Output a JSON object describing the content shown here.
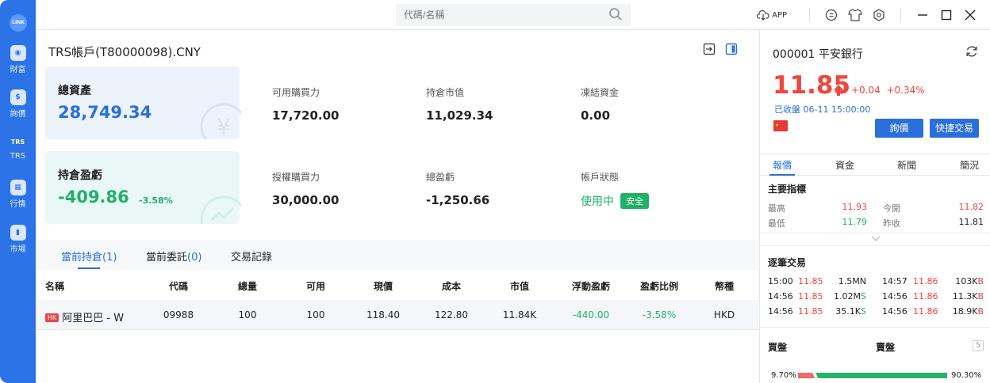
{
  "sidebar": {
    "logo": "LINK",
    "items": [
      {
        "label": "財富",
        "icon": "wealth-icon",
        "glyph": "◉"
      },
      {
        "label": "詢價",
        "icon": "quote-icon",
        "glyph": "$"
      },
      {
        "label": "TRS",
        "icon": "trs-icon",
        "glyph": "TRS"
      },
      {
        "label": "行情",
        "icon": "market-grid-icon",
        "glyph": "▦"
      },
      {
        "label": "市場",
        "icon": "bar-chart-icon",
        "glyph": "▮"
      }
    ]
  },
  "topbar": {
    "search_placeholder": "代碼/名稱",
    "app_label": "APP"
  },
  "account": {
    "title": "TRS帳戶(T80000098).CNY",
    "total_assets_label": "總資產",
    "total_assets_value": "28,749.34",
    "position_pl_label": "持倉盈虧",
    "position_pl_value": "-409.86",
    "position_pl_pct": "-3.58%",
    "stats": [
      {
        "label": "可用購買力",
        "value": "17,720.00"
      },
      {
        "label": "持倉市值",
        "value": "11,029.34"
      },
      {
        "label": "凍結資金",
        "value": "0.00"
      },
      {
        "label": "授權購買力",
        "value": "30,000.00"
      },
      {
        "label": "總盈虧",
        "value": "-1,250.66"
      }
    ],
    "status_label": "帳戶狀態",
    "status_value": "使用中",
    "status_badge": "安全"
  },
  "tabs": [
    {
      "label": "當前持倉",
      "count": "(1)"
    },
    {
      "label": "當前委託",
      "count": "(0)"
    },
    {
      "label": "交易記錄",
      "count": ""
    }
  ],
  "table": {
    "headers": [
      "名稱",
      "代碼",
      "總量",
      "可用",
      "現價",
      "成本",
      "市值",
      "浮動盈虧",
      "盈虧比例",
      "幣種"
    ],
    "rows": [
      {
        "tag": "HK",
        "name": "阿里巴巴 - W",
        "code": "09988",
        "total": "100",
        "available": "100",
        "price": "118.40",
        "cost": "122.80",
        "market_value": "11.84K",
        "float_pl": "-440.00",
        "pl_ratio": "-3.58%",
        "currency": "HKD"
      }
    ]
  },
  "quote": {
    "name": "000001 平安銀行",
    "price": "11.85",
    "change": "+0.04",
    "change_pct": "+0.34%",
    "status": "已收盤 06-11 15:00:00",
    "btn_quote": "詢價",
    "btn_fast_trade": "快捷交易",
    "tabs": [
      "報價",
      "資金",
      "新聞",
      "簡況"
    ],
    "key_indicators_title": "主要指標",
    "indicators": [
      {
        "label": "最高",
        "value": "11.93"
      },
      {
        "label": "今開",
        "value": "11.82"
      },
      {
        "label": "最低",
        "value": "11.79"
      },
      {
        "label": "昨收",
        "value": "11.81"
      }
    ],
    "trades_title": "逐筆交易",
    "trades": [
      {
        "time": "15:00",
        "price": "11.85",
        "vol": "1.5M",
        "side": "N"
      },
      {
        "time": "14:57",
        "price": "11.86",
        "vol": "103K",
        "side": "B"
      },
      {
        "time": "14:56",
        "price": "11.85",
        "vol": "1.02M",
        "side": "S"
      },
      {
        "time": "14:56",
        "price": "11.86",
        "vol": "11.3K",
        "side": "B"
      },
      {
        "time": "14:56",
        "price": "11.85",
        "vol": "35.1K",
        "side": "S"
      },
      {
        "time": "14:56",
        "price": "11.86",
        "vol": "18.9K",
        "side": "B"
      }
    ],
    "buy_label": "買盤",
    "sell_label": "賣盤",
    "depth_badge": "5",
    "buy_pct": "9.70%",
    "sell_pct": "90.30%",
    "buy_fraction": 0.097
  },
  "colors": {
    "brand": "#2b73e6",
    "up": "#f0473d",
    "down": "#1fb167"
  }
}
